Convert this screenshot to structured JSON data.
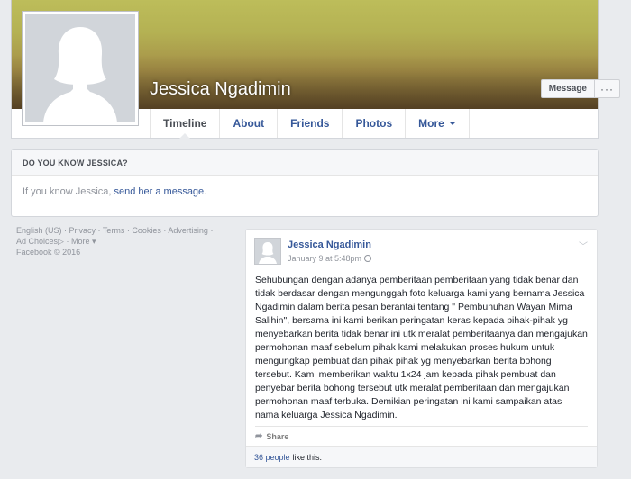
{
  "profile": {
    "name": "Jessica Ngadimin",
    "message_button": "Message",
    "more_button": "···"
  },
  "nav": {
    "tabs": [
      {
        "label": "Timeline"
      },
      {
        "label": "About"
      },
      {
        "label": "Friends"
      },
      {
        "label": "Photos"
      },
      {
        "label": "More"
      }
    ]
  },
  "know_card": {
    "header": "DO YOU KNOW JESSICA?",
    "text_before": "If you know Jessica, ",
    "link": "send her a message",
    "text_after": "."
  },
  "footer": {
    "links": [
      "English (US)",
      "Privacy",
      "Terms",
      "Cookies",
      "Advertising",
      "Ad Choices",
      "More"
    ],
    "copyright": "Facebook © 2016"
  },
  "post": {
    "author": "Jessica Ngadimin",
    "date": "January 9 at 5:48pm",
    "text": "Sehubungan dengan adanya pemberitaan pemberitaan yang tidak benar dan tidak berdasar dengan mengunggah foto keluarga kami yang bernama Jessica Ngadimin dalam berita pesan berantai tentang \" Pembunuhan Wayan Mirna Salihin\", bersama ini kami berikan peringatan keras kepada pihak-pihak yg menyebarkan berita tidak benar ini utk meralat pemberitaanya dan mengajukan permohonan maaf sebelum pihak kami melakukan proses hukum untuk mengungkap pembuat dan pihak pihak yg menyebarkan berita bohong tersebut. Kami memberikan waktu 1x24 jam kepada pihak pembuat dan penyebar berita bohong tersebut utk meralat pemberitaan dan mengajukan permohonan maaf terbuka. Demikian peringatan ini kami sampaikan atas nama keluarga Jessica Ngadimin.",
    "share_label": "Share",
    "likes_link": "36 people",
    "likes_suffix": "like this."
  },
  "colors": {
    "link": "#365899",
    "background": "#e9ebee"
  }
}
